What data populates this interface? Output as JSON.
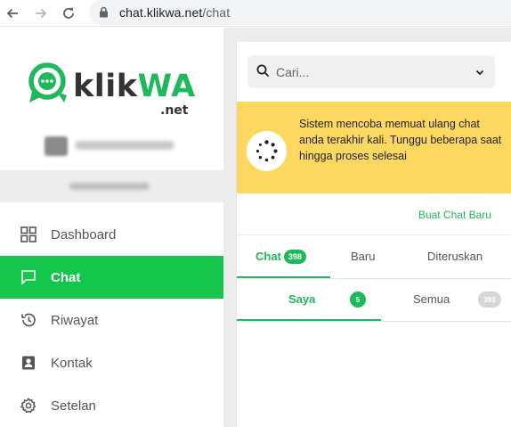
{
  "browser": {
    "url_host": "chat.klikwa.net",
    "url_path": "/chat"
  },
  "brand": {
    "logo_main_a": "klik",
    "logo_main_b": "WA",
    "logo_sub": ".net",
    "accent_color": "#16c54c",
    "notice_color": "#fcd860"
  },
  "sidebar": {
    "items": [
      {
        "label": "Dashboard",
        "icon": "grid-icon"
      },
      {
        "label": "Chat",
        "icon": "chat-bubble-icon"
      },
      {
        "label": "Riwayat",
        "icon": "history-icon"
      },
      {
        "label": "Kontak",
        "icon": "contact-card-icon"
      },
      {
        "label": "Setelan",
        "icon": "gear-icon"
      }
    ]
  },
  "search": {
    "placeholder": "Cari..."
  },
  "notice": {
    "text": "Sistem mencoba memuat ulang chat anda terakhir kali. Tunggu beberapa saat hingga proses selesai"
  },
  "actions": {
    "new_chat": "Buat Chat Baru"
  },
  "tabs": [
    {
      "label": "Chat",
      "badge": "398"
    },
    {
      "label": "Baru"
    },
    {
      "label": "Diteruskan"
    }
  ],
  "subtabs": [
    {
      "label": "Saya",
      "count": "5"
    },
    {
      "label": "Semua",
      "count": "393"
    }
  ]
}
